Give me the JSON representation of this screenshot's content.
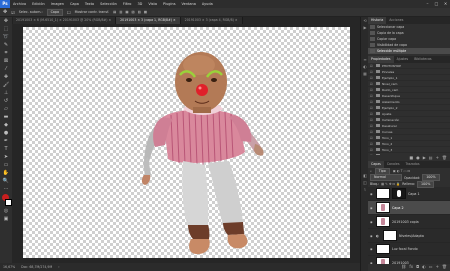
{
  "menubar": {
    "logo": "Ps",
    "items": [
      "Archivo",
      "Edición",
      "Imagen",
      "Capa",
      "Texto",
      "Selección",
      "Filtro",
      "3D",
      "Vista",
      "Plugins",
      "Ventana",
      "Ayuda"
    ]
  },
  "options": {
    "auto_select_label": "Selec. autom.:",
    "auto_select_value": "Capa",
    "transform_label": "Mostrar contr. transf."
  },
  "tabs": [
    {
      "label": "20191003 × 6 (M-6510_1) × 20191003 @ 20% (RGB/8#) ×",
      "active": false
    },
    {
      "label": "20191003 × 3 (capa 1, RGB/8#) ×",
      "active": true
    },
    {
      "label": "20191003 × 3 (capa 4, RGB/8) ×",
      "active": false
    }
  ],
  "status": {
    "zoom": "16,67%",
    "doc_info": "Doc: 68,7M/274,9M"
  },
  "history_panel": {
    "tabs": [
      "Historia",
      "Acciones"
    ],
    "active_tab": "Historia",
    "items": [
      {
        "label": "Seleccionar capa",
        "selected": false
      },
      {
        "label": "Copia de la capa",
        "selected": false
      },
      {
        "label": "Copiar capa",
        "selected": false
      },
      {
        "label": "Visibilidad de capa",
        "selected": false
      },
      {
        "label": "Selección múltiple",
        "selected": true
      }
    ]
  },
  "properties_panel": {
    "tabs": [
      "Propiedades",
      "Ajustes",
      "Bibliotecas"
    ],
    "rows": [
      "PHOTOSHOP",
      "Pinceles",
      "Ejemplo_1",
      "Nivel_cam",
      "Ruido_cam",
      "Desenfoque",
      "Aislamiento",
      "Ejemplo_2",
      "Ajuste",
      "Iluminación",
      "Desaturar",
      "Curvas",
      "Tono_1",
      "Tono_2",
      "Tono_3",
      "Filtro",
      "Espejo"
    ],
    "selected_index": 16
  },
  "layers_panel": {
    "tabs": [
      "Capas",
      "Canales",
      "Trazados"
    ],
    "filter_label": "Tipo",
    "blend_mode": "Normal",
    "opacity_label": "Opacidad:",
    "opacity_value": "100%",
    "fill_label": "Relleno:",
    "fill_value": "100%",
    "lock_label": "Bloq.:",
    "layers": [
      {
        "name": "Capa 1",
        "selected": false,
        "thumb": "doll-mask"
      },
      {
        "name": "Capa 2",
        "selected": true,
        "thumb": "doll"
      },
      {
        "name": "20191003 copia",
        "selected": false,
        "thumb": "doll"
      },
      {
        "name": "Niveles/Adapta",
        "selected": false,
        "thumb": "adjust"
      },
      {
        "name": "Luz focal Fondo",
        "selected": false,
        "thumb": "white"
      },
      {
        "name": "20191003",
        "selected": false,
        "thumb": "doll"
      }
    ]
  },
  "colors": {
    "accent": "#2a6bd8",
    "foreground_swatch": "#c81e1e",
    "background_swatch": "#ffffff"
  }
}
